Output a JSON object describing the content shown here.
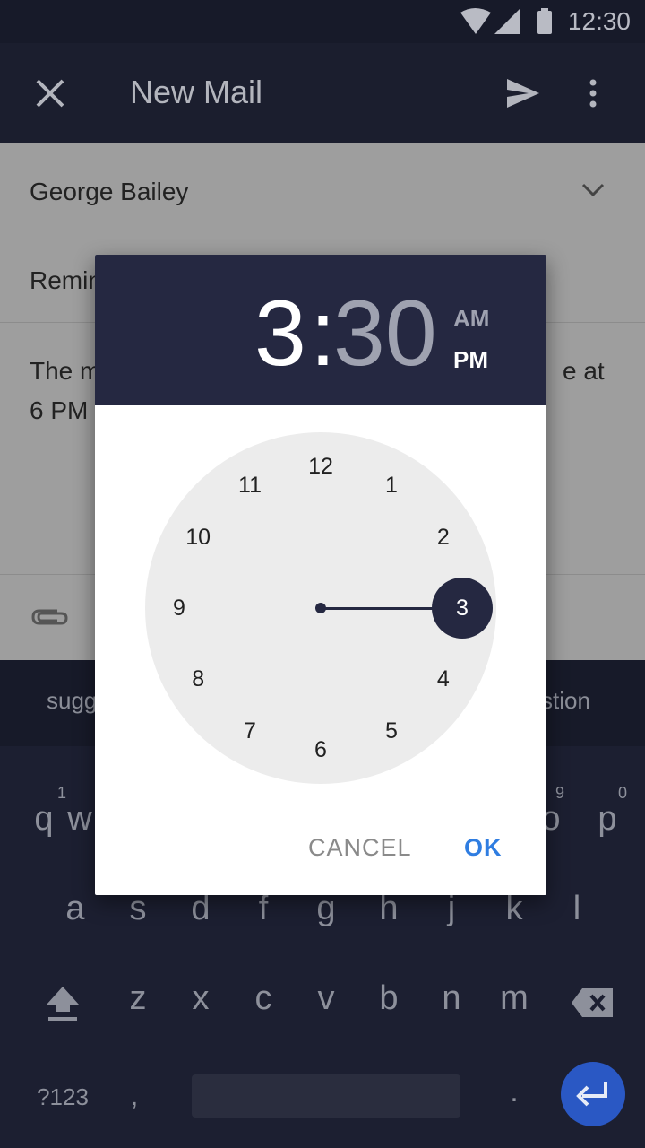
{
  "status_bar": {
    "time": "12:30",
    "icons": [
      "wifi-icon",
      "signal-icon",
      "battery-icon"
    ]
  },
  "app_bar": {
    "title": "New Mail",
    "close_icon": "close-icon",
    "send_icon": "send-icon",
    "menu_icon": "more-vert-icon"
  },
  "mail": {
    "to": "George Bailey",
    "subject_visible": "Remin",
    "body_line1_left": "The m",
    "body_line1_right": "e at",
    "body_line2_left": "6 PM",
    "attach_icon": "attach-icon",
    "expand_icon": "chevron-down-icon"
  },
  "keyboard": {
    "suggestions": {
      "left": "sugg",
      "right": "stion"
    },
    "row1": {
      "q": "q",
      "q_hint": "1",
      "w": "w",
      "o": "o",
      "o_hint": "9",
      "p": "p",
      "p_hint": "0"
    },
    "row2": [
      "a",
      "s",
      "d",
      "f",
      "g",
      "h",
      "j",
      "k",
      "l"
    ],
    "row3": [
      "z",
      "x",
      "c",
      "v",
      "b",
      "n",
      "m"
    ],
    "bottom": {
      "symbols": "?123",
      "comma": ",",
      "period": "."
    }
  },
  "time_picker": {
    "hour": "3",
    "separator": ":",
    "minute": "30",
    "am": "AM",
    "pm": "PM",
    "selected_hour": "3",
    "selected_period": "PM",
    "clock_numbers": [
      "12",
      "1",
      "2",
      "3",
      "4",
      "5",
      "6",
      "7",
      "8",
      "9",
      "10",
      "11"
    ],
    "cancel_label": "CANCEL",
    "ok_label": "OK"
  },
  "colors": {
    "header": "#252841",
    "accent": "#2f7de1",
    "face": "#ececec"
  }
}
